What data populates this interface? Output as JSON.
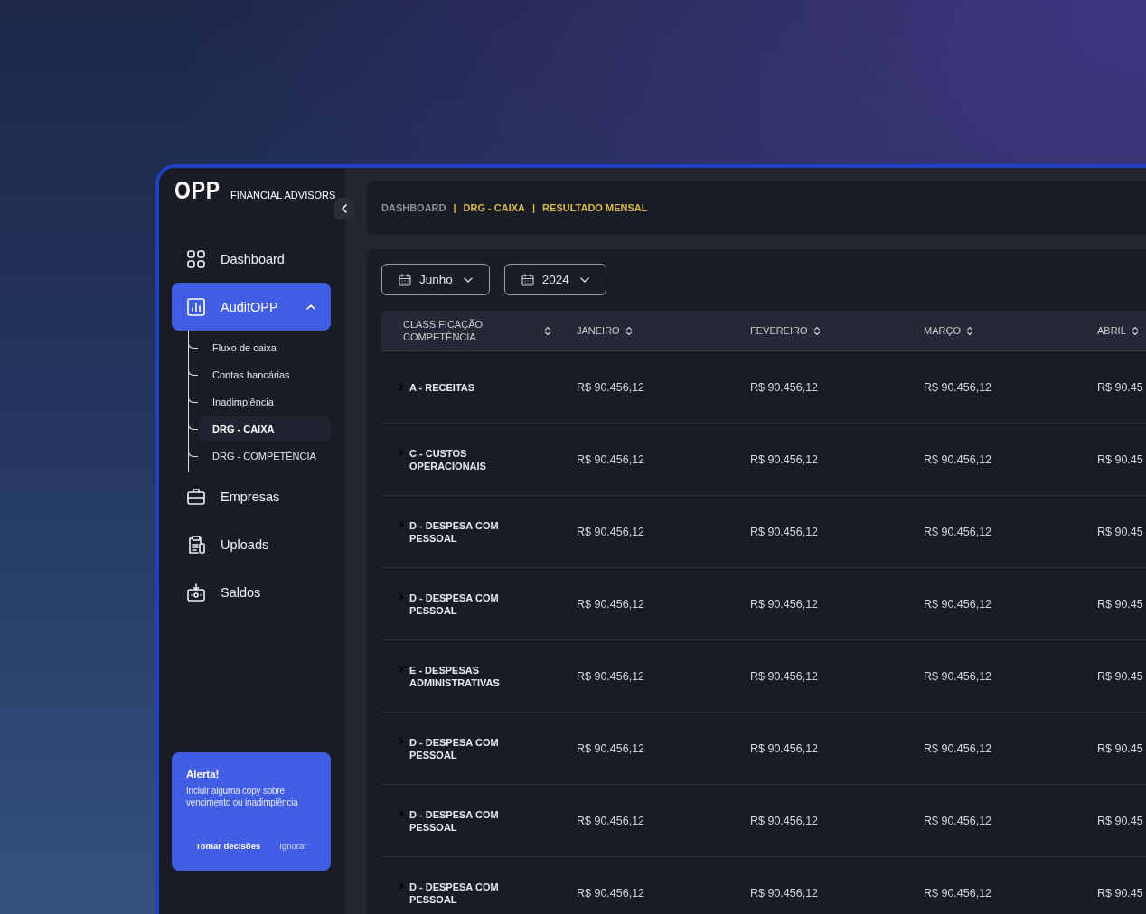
{
  "brand": {
    "logo": "OPP",
    "name": "FINANCIAL ADVISORS"
  },
  "sidebar": {
    "items": [
      {
        "label": "Dashboard",
        "selected": false
      },
      {
        "label": "AuditOPP",
        "selected": true,
        "expanded": true,
        "children": [
          {
            "label": "Fluxo de caixa",
            "selected": false
          },
          {
            "label": "Contas bancárias",
            "selected": false
          },
          {
            "label": "Inadimplência",
            "selected": false
          },
          {
            "label": "DRG - CAIXA",
            "selected": true
          },
          {
            "label": "DRG - COMPETÊNCIA",
            "selected": false
          }
        ]
      },
      {
        "label": "Empresas",
        "selected": false
      },
      {
        "label": "Uploads",
        "selected": false
      },
      {
        "label": "Saldos",
        "selected": false
      }
    ]
  },
  "alert": {
    "title": "Alerta!",
    "text": "Incluir alguma copy sobre vencimento ou inadimplência",
    "actions": [
      {
        "label": "Tomar decisões",
        "kind": "primary"
      },
      {
        "label": "Ignorar",
        "kind": "secondary"
      }
    ]
  },
  "breadcrumb": [
    {
      "kind": "link",
      "label": "DASHBOARD",
      "highlighted": false
    },
    {
      "kind": "separator",
      "label": "|"
    },
    {
      "kind": "link",
      "label": "DRG - CAIXA",
      "highlighted": true
    },
    {
      "kind": "separator",
      "label": "|"
    },
    {
      "kind": "link",
      "label": "RESULTADO MENSAL",
      "highlighted": true
    }
  ],
  "filters": [
    {
      "label": "Junho"
    },
    {
      "label": "2024"
    }
  ],
  "table": {
    "columns": [
      "CLASSIFICAÇÃO COMPETÊNCIA",
      "JANEIRO",
      "FEVEREIRO",
      "MARÇO",
      "ABRIL"
    ],
    "rows": [
      {
        "label": "A - RECEITAS",
        "expanded": false,
        "values": [
          "R$ 90.456,12",
          "R$ 90.456,12",
          "R$ 90.456,12",
          "R$ 90.45"
        ]
      },
      {
        "label": "C - CUSTOS OPERACIONAIS",
        "expanded": false,
        "values": [
          "R$ 90.456,12",
          "R$ 90.456,12",
          "R$ 90.456,12",
          "R$ 90.45"
        ]
      },
      {
        "label": "D - DESPESA COM PESSOAL",
        "expanded": false,
        "values": [
          "R$ 90.456,12",
          "R$ 90.456,12",
          "R$ 90.456,12",
          "R$ 90.45"
        ]
      },
      {
        "label": "D - DESPESA COM PESSOAL",
        "expanded": false,
        "values": [
          "R$ 90.456,12",
          "R$ 90.456,12",
          "R$ 90.456,12",
          "R$ 90.45"
        ]
      },
      {
        "label": "E - DESPESAS ADMINISTRATIVAS",
        "expanded": false,
        "values": [
          "R$ 90.456,12",
          "R$ 90.456,12",
          "R$ 90.456,12",
          "R$ 90.45"
        ]
      },
      {
        "label": "D - DESPESA COM PESSOAL",
        "expanded": false,
        "values": [
          "R$ 90.456,12",
          "R$ 90.456,12",
          "R$ 90.456,12",
          "R$ 90.45"
        ]
      },
      {
        "label": "D - DESPESA COM PESSOAL",
        "expanded": false,
        "values": [
          "R$ 90.456,12",
          "R$ 90.456,12",
          "R$ 90.456,12",
          "R$ 90.45"
        ]
      },
      {
        "label": "D - DESPESA COM PESSOAL",
        "expanded": false,
        "values": [
          "R$ 90.456,12",
          "R$ 90.456,12",
          "R$ 90.456,12",
          "R$ 90.45"
        ]
      }
    ]
  }
}
